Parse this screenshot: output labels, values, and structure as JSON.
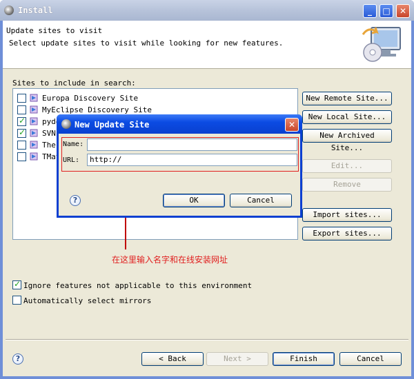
{
  "window": {
    "title": "Install"
  },
  "header": {
    "title": "Update sites to visit",
    "description": "Select update sites to visit while looking for new features."
  },
  "sites": {
    "label": "Sites to include in search:",
    "items": [
      {
        "label": "Europa Discovery Site",
        "checked": false
      },
      {
        "label": "MyEclipse Discovery Site",
        "checked": false
      },
      {
        "label": "pyde",
        "checked": true
      },
      {
        "label": "SVN",
        "checked": true
      },
      {
        "label": "The",
        "checked": false
      },
      {
        "label": "TMat",
        "checked": false
      }
    ]
  },
  "side_buttons": {
    "new_remote": "New Remote Site...",
    "new_local": "New Local Site...",
    "new_archived": "New Archived Site...",
    "edit": "Edit...",
    "remove": "Remove",
    "import": "Import sites...",
    "export": "Export sites..."
  },
  "options": {
    "ignore": {
      "label": "Ignore features not applicable to this environment",
      "checked": true
    },
    "mirrors": {
      "label": "Automatically select mirrors",
      "checked": false
    }
  },
  "footer": {
    "back": "< Back",
    "next": "Next >",
    "finish": "Finish",
    "cancel": "Cancel"
  },
  "dialog": {
    "title": "New Update Site",
    "name_label": "Name:",
    "name_value": "",
    "url_label": "URL:",
    "url_value": "http://",
    "ok": "OK",
    "cancel": "Cancel"
  },
  "annotation": {
    "text": "在这里输入名字和在线安装网址",
    "color": "#e01e1e"
  },
  "colors": {
    "titlebar_active": "#0a40cf",
    "dialog_face": "#ece9d8",
    "annotation_red": "#e01e1e"
  }
}
